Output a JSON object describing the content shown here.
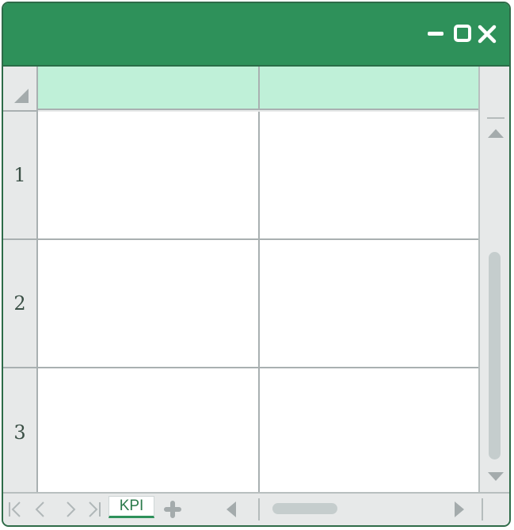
{
  "window": {
    "controls": [
      {
        "name": "minimize",
        "icon": "minimize-icon"
      },
      {
        "name": "maximize",
        "icon": "maximize-icon"
      },
      {
        "name": "close",
        "icon": "close-icon"
      }
    ],
    "titlebar_color": "#2e915a"
  },
  "sheet": {
    "column_headers": [
      "",
      ""
    ],
    "header_color": "#bff0d8",
    "rows": [
      {
        "label": "1",
        "cells": [
          "",
          ""
        ]
      },
      {
        "label": "2",
        "cells": [
          "",
          ""
        ]
      },
      {
        "label": "3",
        "cells": [
          "",
          ""
        ]
      }
    ]
  },
  "tabs": {
    "active": "KPI",
    "nav_icons": [
      "first-sheet-icon",
      "prev-sheet-icon",
      "next-sheet-icon",
      "last-sheet-icon"
    ],
    "add_icon": "plus-icon"
  }
}
